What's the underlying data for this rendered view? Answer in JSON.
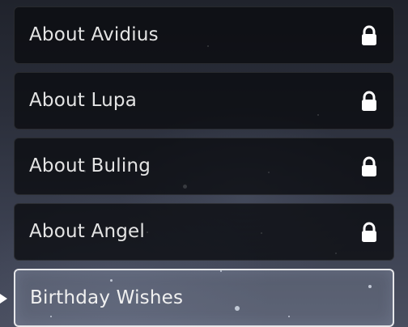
{
  "menu": {
    "items": [
      {
        "label": "About Avidius",
        "locked": true,
        "icon": "lock-icon"
      },
      {
        "label": "About Lupa",
        "locked": true,
        "icon": "lock-icon"
      },
      {
        "label": "About Buling",
        "locked": true,
        "icon": "lock-icon"
      },
      {
        "label": "About Angel",
        "locked": true,
        "icon": "lock-icon"
      },
      {
        "label": "Birthday Wishes",
        "locked": false,
        "selected": true
      }
    ]
  },
  "colors": {
    "item_bg": "#0a0c10",
    "text": "#e4e4e4",
    "selected_border": "#ffffff"
  }
}
